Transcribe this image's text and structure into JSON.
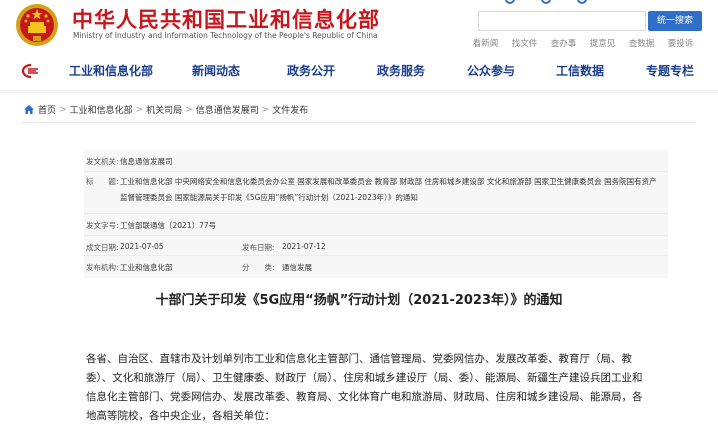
{
  "header": {
    "site_title": "中华人民共和国工业和信息化部",
    "site_subtitle": "Ministry of Industry and Information Technology of the People's Republic of China",
    "search_placeholder": "",
    "search_button": "统一搜索",
    "quick_links": [
      "看新闻",
      "找文件",
      "查办事",
      "提意见",
      "查数据",
      "要投诉"
    ]
  },
  "nav": {
    "items": [
      "工业和信息化部",
      "新闻动态",
      "政务公开",
      "政务服务",
      "公众参与",
      "工信数据",
      "专题专栏"
    ]
  },
  "breadcrumb": {
    "items": [
      "首页",
      "工业和信息化部",
      "机关司局",
      "信息通信发展司",
      "文件发布"
    ],
    "separator": ">"
  },
  "meta": {
    "issuer_label": "发文机关:",
    "issuer_value": "信息通信发展司",
    "title_label": "标　　题:",
    "title_value": "工业和信息化部 中央网络安全和信息化委员会办公室 国家发展和改革委员会 教育部 财政部 住房和城乡建设部 文化和旅游部 国家卫生健康委员会 国务院国有资产监督管理委员会 国家能源局关于印发《5G应用“扬帆”行动计划（2021-2023年）》的通知",
    "docno_label": "发文字号:",
    "docno_value": "工信部联通信〔2021〕77号",
    "created_label": "成文日期:",
    "created_value": "2021-07-05",
    "published_label": "发布日期:",
    "published_value": "2021-07-12",
    "org_label": "发布机构:",
    "org_value": "工业和信息化部",
    "category_label": "分　　类:",
    "category_value": "通信发展"
  },
  "document": {
    "title": "十部门关于印发《5G应用“扬帆”行动计划（2021-2023年）》的通知",
    "body": "各省、自治区、直辖市及计划单列市工业和信息化主管部门、通信管理局、党委网信办、发展改革委、教育厅（局、教委）、文化和旅游厅（局）、卫生健康委、财政厅（局）、住房和城乡建设厅（局、委）、能源局、新疆生产建设兵团工业和信息化主管部门、党委网信办、发展改革委、教育局、文化体育广电和旅游局、财政局、住房和城乡建设局、能源局，各地高等院校，各中央企业，各相关单位："
  },
  "colors": {
    "brand_red": "#c8161d",
    "nav_blue": "#1a3e8f",
    "button_blue": "#2f6fc9"
  }
}
